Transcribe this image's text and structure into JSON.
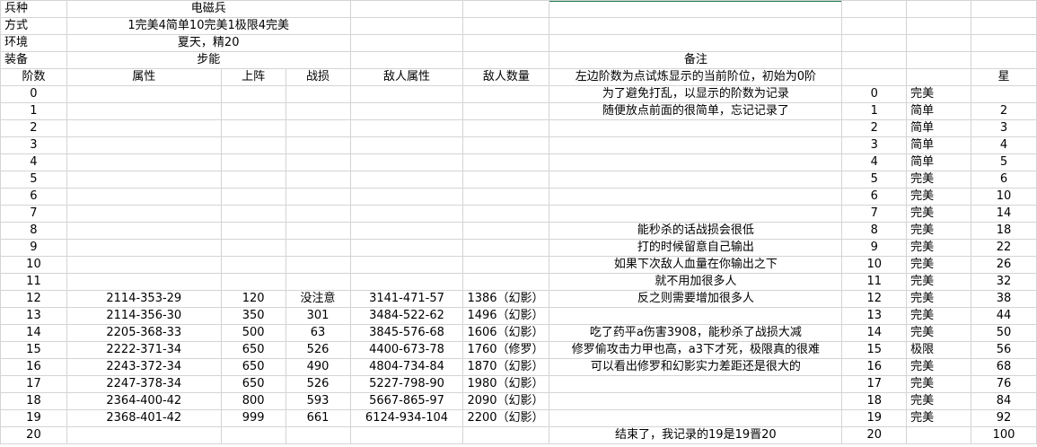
{
  "header": {
    "unit_label": "兵种",
    "unit_value": "电磁兵",
    "method_label": "方式",
    "method_value": "1完美4简单10完美1极限4完美",
    "env_label": "环境",
    "env_value": "夏天，精20",
    "equip_label": "装备",
    "equip_value": "步能",
    "notes_label": "备注"
  },
  "columns": [
    "阶数",
    "属性",
    "上阵",
    "战损",
    "敌人属性",
    "敌人数量",
    "左边阶数为点试炼显示的当前阶位，初始为0阶",
    "",
    "",
    "星"
  ],
  "rows": [
    {
      "tier": "0",
      "attr": "",
      "deploy": "",
      "loss": "",
      "enemy_attr": "",
      "enemy_count": "",
      "note": "为了避免打乱，以显示的阶数为记录",
      "disp_tier": "0",
      "grade": "完美",
      "stars": ""
    },
    {
      "tier": "1",
      "attr": "",
      "deploy": "",
      "loss": "",
      "enemy_attr": "",
      "enemy_count": "",
      "note": "随便放点前面的很简单，忘记记录了",
      "disp_tier": "1",
      "grade": "简单",
      "stars": "2"
    },
    {
      "tier": "2",
      "attr": "",
      "deploy": "",
      "loss": "",
      "enemy_attr": "",
      "enemy_count": "",
      "note": "",
      "disp_tier": "2",
      "grade": "简单",
      "stars": "3"
    },
    {
      "tier": "3",
      "attr": "",
      "deploy": "",
      "loss": "",
      "enemy_attr": "",
      "enemy_count": "",
      "note": "",
      "disp_tier": "3",
      "grade": "简单",
      "stars": "4"
    },
    {
      "tier": "4",
      "attr": "",
      "deploy": "",
      "loss": "",
      "enemy_attr": "",
      "enemy_count": "",
      "note": "",
      "disp_tier": "4",
      "grade": "简单",
      "stars": "5"
    },
    {
      "tier": "5",
      "attr": "",
      "deploy": "",
      "loss": "",
      "enemy_attr": "",
      "enemy_count": "",
      "note": "",
      "disp_tier": "5",
      "grade": "完美",
      "stars": "6"
    },
    {
      "tier": "6",
      "attr": "",
      "deploy": "",
      "loss": "",
      "enemy_attr": "",
      "enemy_count": "",
      "note": "",
      "disp_tier": "6",
      "grade": "完美",
      "stars": "10"
    },
    {
      "tier": "7",
      "attr": "",
      "deploy": "",
      "loss": "",
      "enemy_attr": "",
      "enemy_count": "",
      "note": "",
      "disp_tier": "7",
      "grade": "完美",
      "stars": "14"
    },
    {
      "tier": "8",
      "attr": "",
      "deploy": "",
      "loss": "",
      "enemy_attr": "",
      "enemy_count": "",
      "note": "能秒杀的话战损会很低",
      "disp_tier": "8",
      "grade": "完美",
      "stars": "18"
    },
    {
      "tier": "9",
      "attr": "",
      "deploy": "",
      "loss": "",
      "enemy_attr": "",
      "enemy_count": "",
      "note": "打的时候留意自己输出",
      "disp_tier": "9",
      "grade": "完美",
      "stars": "22"
    },
    {
      "tier": "10",
      "attr": "",
      "deploy": "",
      "loss": "",
      "enemy_attr": "",
      "enemy_count": "",
      "note": "如果下次敌人血量在你输出之下",
      "disp_tier": "10",
      "grade": "完美",
      "stars": "26"
    },
    {
      "tier": "11",
      "attr": "",
      "deploy": "",
      "loss": "",
      "enemy_attr": "",
      "enemy_count": "",
      "note": "就不用加很多人",
      "disp_tier": "11",
      "grade": "完美",
      "stars": "32"
    },
    {
      "tier": "12",
      "attr": "2114-353-29",
      "deploy": "120",
      "loss": "没注意",
      "enemy_attr": "3141-471-57",
      "enemy_count": "1386（幻影）",
      "note": "反之则需要增加很多人",
      "disp_tier": "12",
      "grade": "完美",
      "stars": "38"
    },
    {
      "tier": "13",
      "attr": "2114-356-30",
      "deploy": "350",
      "loss": "301",
      "enemy_attr": "3484-522-62",
      "enemy_count": "1496（幻影）",
      "note": "",
      "disp_tier": "13",
      "grade": "完美",
      "stars": "44"
    },
    {
      "tier": "14",
      "attr": "2205-368-33",
      "deploy": "500",
      "loss": "63",
      "enemy_attr": "3845-576-68",
      "enemy_count": "1606（幻影）",
      "note": "吃了药平a伤害3908，能秒杀了战损大减",
      "disp_tier": "14",
      "grade": "完美",
      "stars": "50"
    },
    {
      "tier": "15",
      "attr": "2222-371-34",
      "deploy": "650",
      "loss": "526",
      "enemy_attr": "4400-673-78",
      "enemy_count": "1760（修罗）",
      "note": "修罗偷攻击力甲也高，a3下才死，极限真的很难",
      "disp_tier": "15",
      "grade": "极限",
      "stars": "56"
    },
    {
      "tier": "16",
      "attr": "2243-372-34",
      "deploy": "650",
      "loss": "490",
      "enemy_attr": "4804-734-84",
      "enemy_count": "1870（幻影）",
      "note": "可以看出修罗和幻影实力差距还是很大的",
      "disp_tier": "16",
      "grade": "完美",
      "stars": "68"
    },
    {
      "tier": "17",
      "attr": "2247-378-34",
      "deploy": "650",
      "loss": "526",
      "enemy_attr": "5227-798-90",
      "enemy_count": "1980（幻影）",
      "note": "",
      "disp_tier": "17",
      "grade": "完美",
      "stars": "76"
    },
    {
      "tier": "18",
      "attr": "2364-400-42",
      "deploy": "800",
      "loss": "593",
      "enemy_attr": "5667-865-97",
      "enemy_count": "2090（幻影）",
      "note": "",
      "disp_tier": "18",
      "grade": "完美",
      "stars": "84"
    },
    {
      "tier": "19",
      "attr": "2368-401-42",
      "deploy": "999",
      "loss": "661",
      "enemy_attr": "6124-934-104",
      "enemy_count": "2200（幻影）",
      "note": "",
      "disp_tier": "19",
      "grade": "完美",
      "stars": "92"
    },
    {
      "tier": "20",
      "attr": "",
      "deploy": "",
      "loss": "",
      "enemy_attr": "",
      "enemy_count": "",
      "note": "结束了，我记录的19是19晋20",
      "disp_tier": "20",
      "grade": "",
      "stars": "100"
    }
  ]
}
